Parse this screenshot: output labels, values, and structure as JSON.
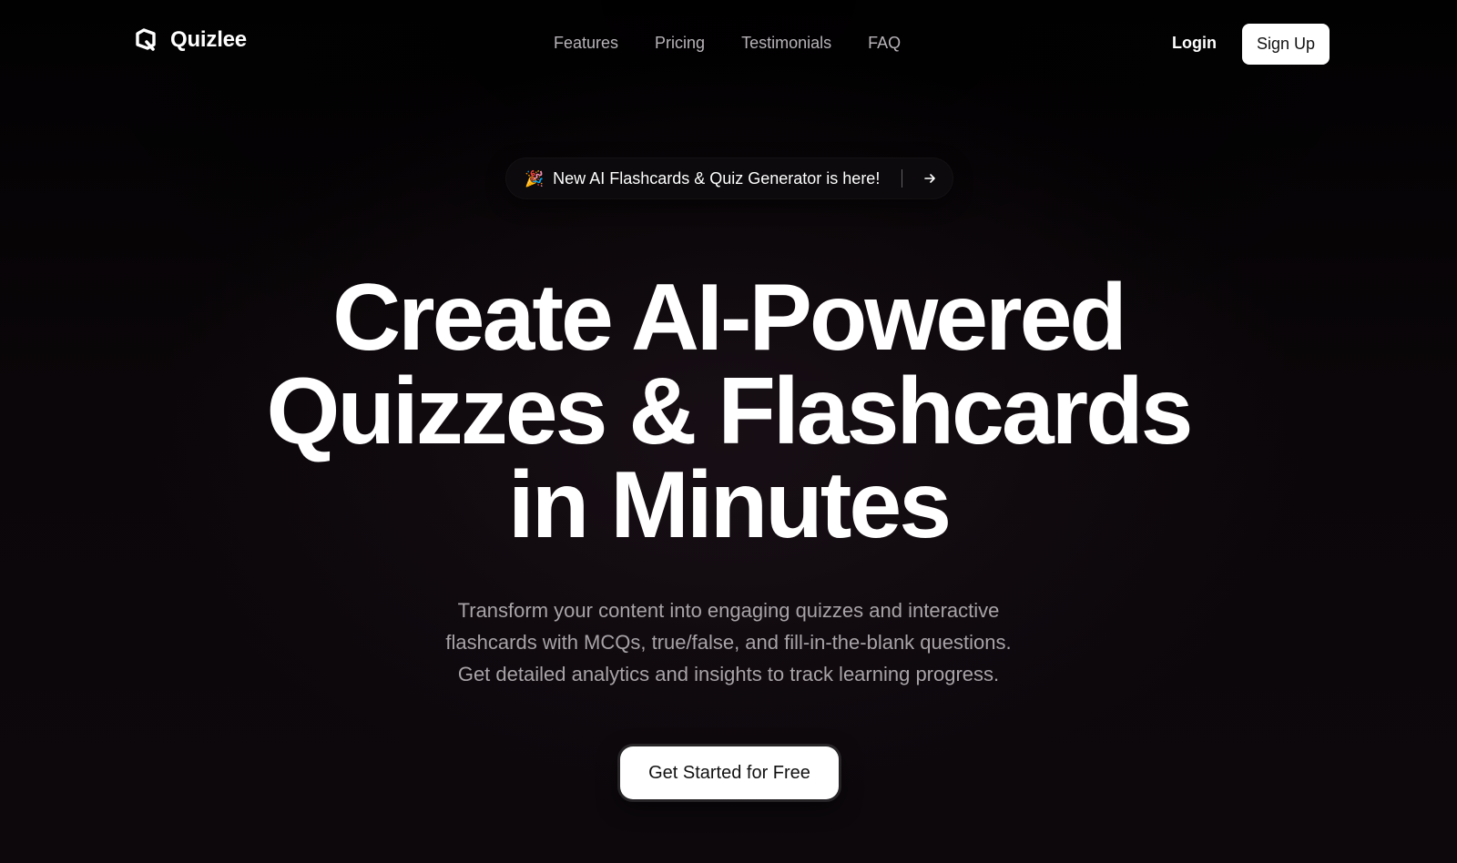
{
  "brand": {
    "name": "Quizlee",
    "logo_icon": "quizlee-logo-icon"
  },
  "nav": {
    "links": [
      "Features",
      "Pricing",
      "Testimonials",
      "FAQ"
    ],
    "login_label": "Login",
    "signup_label": "Sign Up"
  },
  "announcement": {
    "emoji": "🎉",
    "text": "New AI Flashcards & Quiz Generator is here!",
    "arrow_icon": "arrow-right-icon"
  },
  "hero": {
    "headline_lines": [
      "Create AI-Powered",
      "Quizzes & Flashcards",
      "in Minutes"
    ],
    "subtext_lines": [
      "Transform your content into engaging quizzes and interactive",
      "flashcards with MCQs, true/false, and fill-in-the-blank questions.",
      "Get detailed analytics and insights to track learning progress."
    ],
    "cta_label": "Get Started for Free"
  },
  "colors": {
    "background": "#050306",
    "text_primary": "#ffffff",
    "text_muted": "#a7a3a7",
    "nav_link": "#b8b4b8",
    "button_bg": "#ffffff",
    "button_text": "#111111"
  }
}
